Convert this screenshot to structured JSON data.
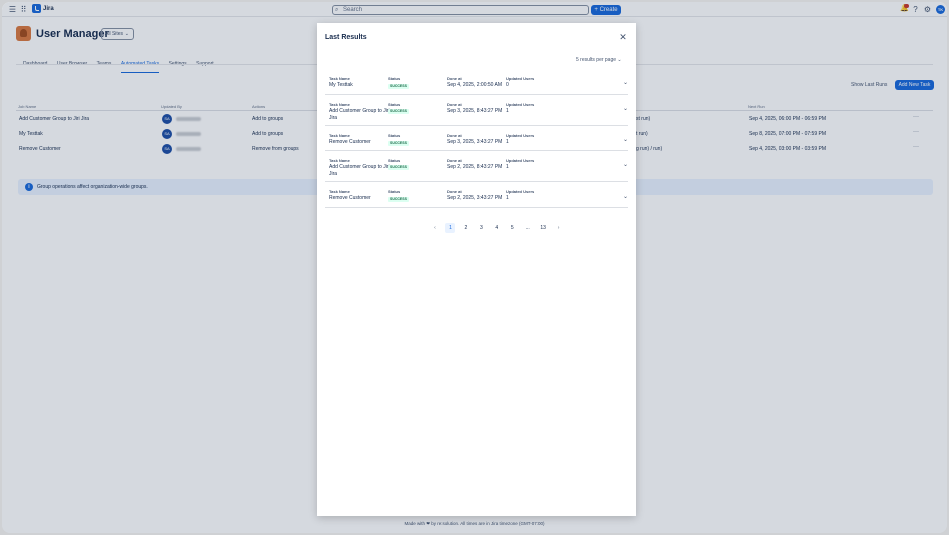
{
  "topbar": {
    "app_name": "Jira",
    "search_placeholder": "Search",
    "create_label": "+ Create",
    "avatar_initials": "TK"
  },
  "page": {
    "title": "User Manager",
    "site_select": "All Sites",
    "nav": [
      "Dashboard",
      "User Browser",
      "Teams",
      "Automated Tasks",
      "Settings",
      "Support"
    ],
    "active_nav": "Automated Tasks",
    "show_last_runs": "Show Last Runs",
    "add_new_task": "Add New Task"
  },
  "table": {
    "headers": {
      "job_name": "Job Name",
      "updated_by": "Updated By",
      "actions": "Actions",
      "next_run": "Next Run"
    },
    "rows": [
      {
        "job": "Add Customer Group to Jiri Jira",
        "avatar": "SA",
        "action": "Add to groups",
        "partial": "st run)",
        "next_run": "Sep 4, 2025, 06:00 PM - 06:59 PM"
      },
      {
        "job": "My Testtak",
        "avatar": "SA",
        "action": "Add to groups",
        "partial": "t run)",
        "next_run": "Sep 8, 2025, 07:00 PM - 07:59 PM"
      },
      {
        "job": "Remove Customer",
        "avatar": "SA",
        "action": "Remove from groups",
        "partial": "g run) / run)",
        "next_run": "Sep 4, 2025, 03:00 PM - 03:59 PM"
      }
    ]
  },
  "banner": {
    "text": "Group operations affect organization-wide groups."
  },
  "footer": {
    "text": "Made with ❤ by re:solution. All times are in Jira timezone (GMT-07:00)"
  },
  "modal": {
    "title": "Last Results",
    "per_page": "5 results per page",
    "labels": {
      "task_name": "Task Name",
      "status": "Status",
      "done_at": "Done at",
      "updated_users": "Updated Users"
    },
    "results": [
      {
        "task": "My Testtak",
        "task2": "",
        "status": "SUCCESS",
        "done_at": "Sep 4, 2025, 2:00:50 AM",
        "updated": "0"
      },
      {
        "task": "Add Customer Group to Jiri",
        "task2": "Jira",
        "status": "SUCCESS",
        "done_at": "Sep 3, 2025, 8:43:27 PM",
        "updated": "1"
      },
      {
        "task": "Remove Customer",
        "task2": "",
        "status": "SUCCESS",
        "done_at": "Sep 3, 2025, 3:43:27 PM",
        "updated": "1"
      },
      {
        "task": "Add Customer Group to Jiri",
        "task2": "Jira",
        "status": "SUCCESS",
        "done_at": "Sep 2, 2025, 8:43:27 PM",
        "updated": "1"
      },
      {
        "task": "Remove Customer",
        "task2": "",
        "status": "SUCCESS",
        "done_at": "Sep 2, 2025, 3:43:27 PM",
        "updated": "1"
      }
    ],
    "pagination": {
      "pages": [
        "1",
        "2",
        "3",
        "4",
        "5",
        "...",
        "13"
      ],
      "current": "1"
    }
  }
}
